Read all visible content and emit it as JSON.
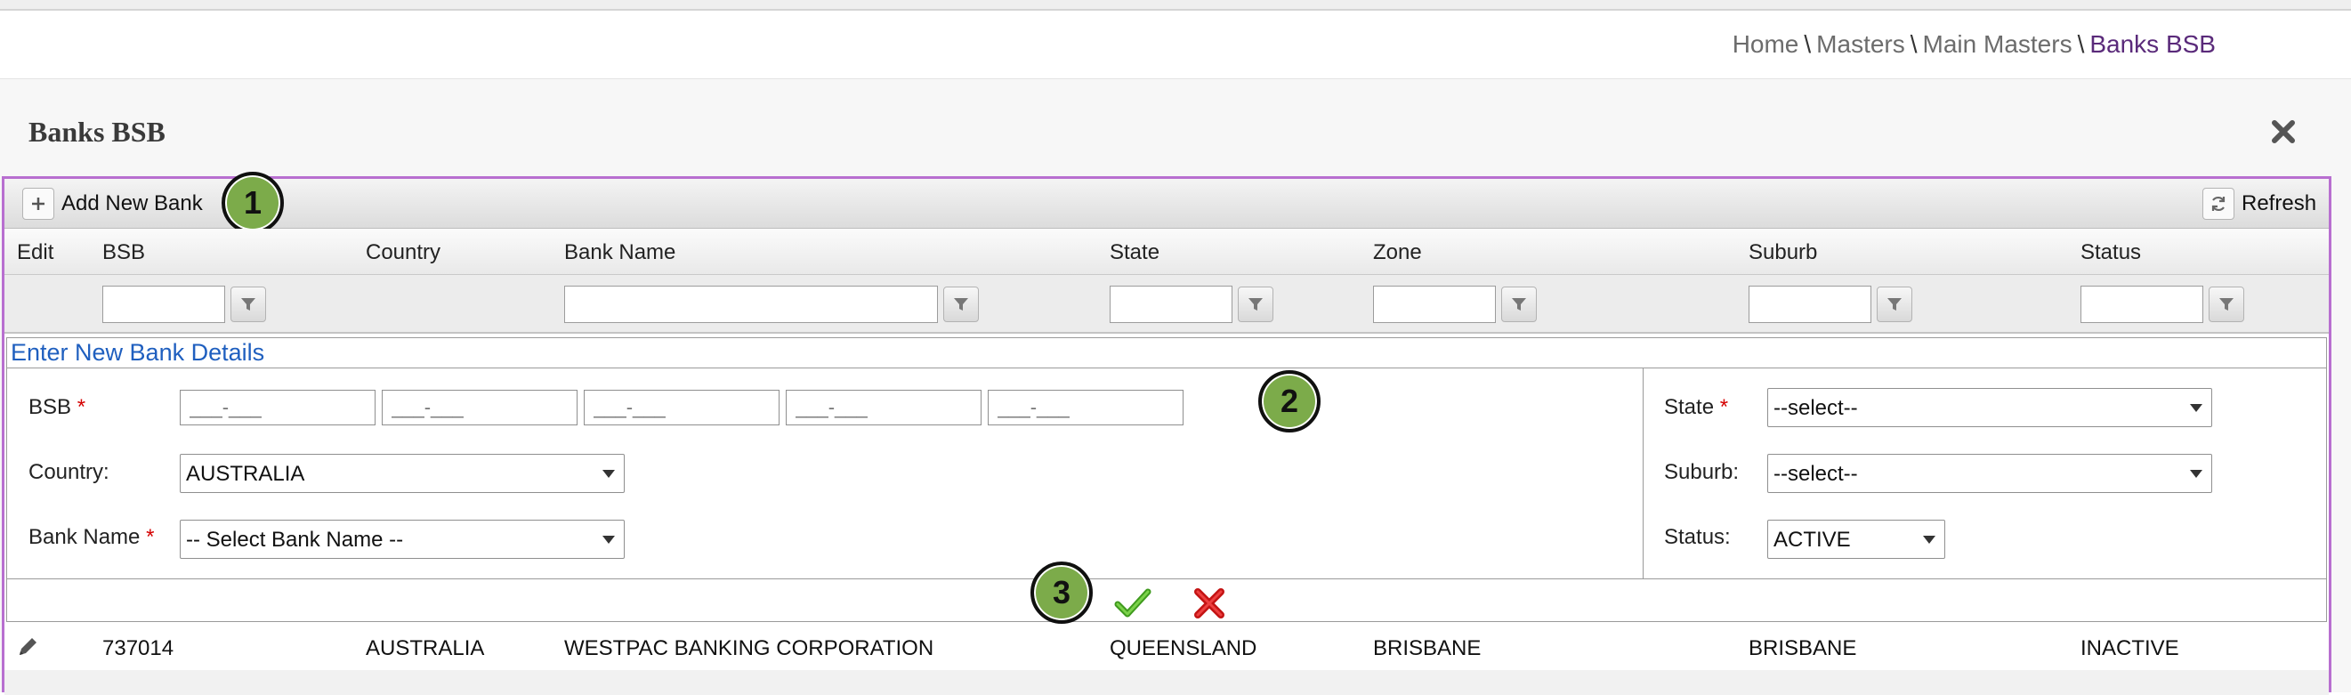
{
  "breadcrumb": {
    "home": "Home",
    "masters": "Masters",
    "main_masters": "Main Masters",
    "current": "Banks BSB",
    "separator": "\\"
  },
  "page": {
    "title": "Banks BSB",
    "close_icon": "close-icon"
  },
  "toolbar": {
    "add_label": "Add New Bank",
    "refresh_label": "Refresh",
    "add_icon": "plus-icon",
    "refresh_icon": "refresh-icon"
  },
  "columns": [
    "Edit",
    "BSB",
    "Country",
    "Bank Name",
    "State",
    "Zone",
    "Suburb",
    "Status"
  ],
  "form": {
    "header": "Enter New Bank Details",
    "bsb_label": "BSB",
    "required_mark": "*",
    "bsb_placeholder": "___-___",
    "country_label": "Country:",
    "country_value": "AUSTRALIA",
    "bank_label": "Bank Name",
    "bank_value": "-- Select Bank Name --",
    "state_label": "State",
    "state_value": "--select--",
    "suburb_label": "Suburb:",
    "suburb_value": "--select--",
    "status_label": "Status:",
    "status_value": "ACTIVE"
  },
  "badges": [
    "1",
    "2",
    "3"
  ],
  "rows": [
    {
      "bsb": "737014",
      "country": "AUSTRALIA",
      "bank": "WESTPAC BANKING CORPORATION",
      "state": "QUEENSLAND",
      "zone": "BRISBANE",
      "suburb": "BRISBANE",
      "status": "INACTIVE"
    }
  ],
  "colors": {
    "accent_border": "#b86fd0",
    "badge_green": "#7cab4a",
    "link_blue": "#1f5fbf",
    "breadcrumb_active": "#5a2a7a"
  }
}
